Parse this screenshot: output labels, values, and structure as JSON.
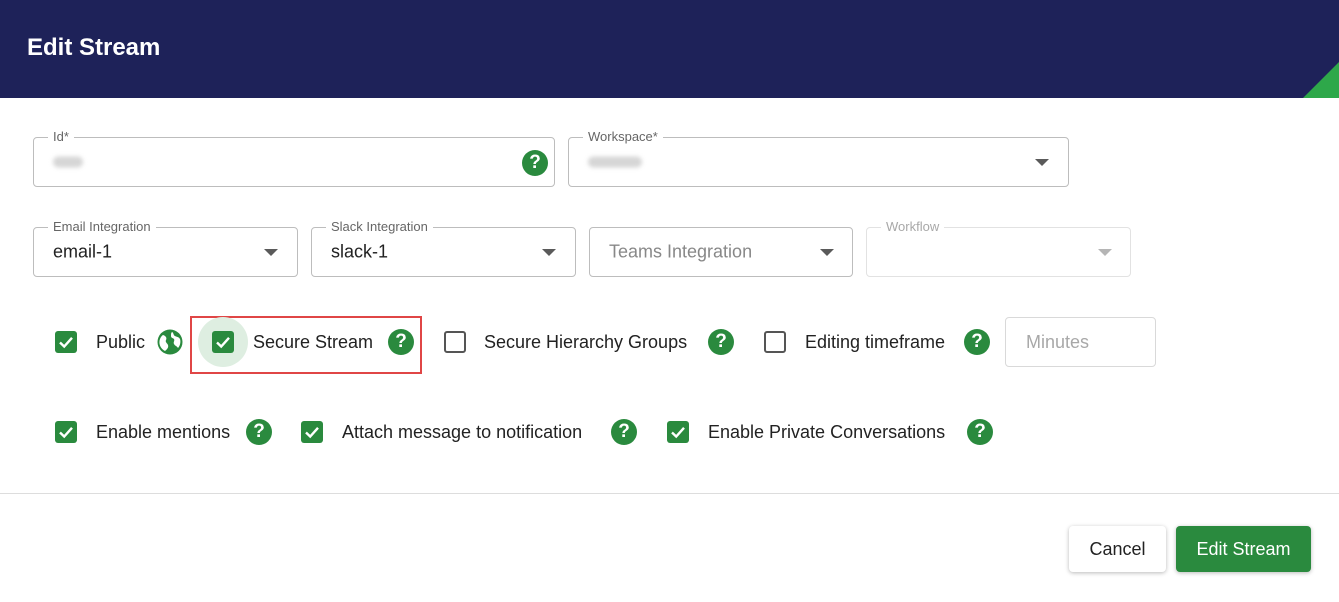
{
  "dialog": {
    "title": "Edit Stream"
  },
  "fields": {
    "id": {
      "label": "Id*"
    },
    "workspace": {
      "label": "Workspace*"
    },
    "email_integration": {
      "label": "Email Integration",
      "value": "email-1"
    },
    "slack_integration": {
      "label": "Slack Integration",
      "value": "slack-1"
    },
    "teams_integration": {
      "placeholder": "Teams Integration"
    },
    "workflow": {
      "label": "Workflow",
      "value": ""
    },
    "editing_timeframe_minutes": {
      "placeholder": "Minutes"
    }
  },
  "options_row1": [
    {
      "label": "Public",
      "checked": true,
      "icon": "globe-icon"
    },
    {
      "label": "Secure Stream",
      "checked": true,
      "icon": "help-icon",
      "highlighted": true
    },
    {
      "label": "Secure Hierarchy Groups",
      "checked": false,
      "icon": "help-icon"
    },
    {
      "label": "Editing timeframe",
      "checked": false,
      "icon": "help-icon"
    }
  ],
  "options_row2": [
    {
      "label": "Enable mentions",
      "checked": true,
      "icon": "help-icon"
    },
    {
      "label": "Attach message to notification",
      "checked": true,
      "icon": "help-icon"
    },
    {
      "label": "Enable Private Conversations",
      "checked": true,
      "icon": "help-icon"
    }
  ],
  "help_glyph": "?",
  "footer": {
    "cancel_label": "Cancel",
    "submit_label": "Edit Stream"
  },
  "colors": {
    "header": "#1e2259",
    "accent": "#2a8a3e",
    "corner": "#2ea84a",
    "highlight_border": "#e04646"
  }
}
